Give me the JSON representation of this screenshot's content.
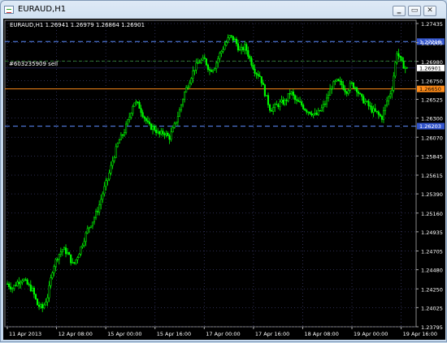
{
  "window": {
    "title": "EURAUD,H1",
    "minimize_glyph": "‗",
    "restore_glyph": "▭",
    "close_glyph": "✕"
  },
  "chart": {
    "header": "EURAUD,H1  1.26941 1.26979 1.26864 1.26901",
    "order_label": "#603235909 sell",
    "colors": {
      "background": "#000000",
      "candles": "#00ff00",
      "grid": "#3a3a6a",
      "axis_text": "#ffffff",
      "order_line": "#ff8c1a",
      "tp_sl_line": "#5b8cff",
      "bid_line": "#ffffff"
    }
  },
  "chart_data": {
    "type": "candlestick",
    "symbol": "EURAUD",
    "timeframe": "H1",
    "ohlc_last": {
      "open": 1.26941,
      "high": 1.26979,
      "low": 1.26864,
      "close": 1.26901
    },
    "y_ticks": [
      1.27435,
      1.27205,
      1.2698,
      1.2675,
      1.26525,
      1.263,
      1.2607,
      1.25845,
      1.25615,
      1.2539,
      1.2516,
      1.24935,
      1.24705,
      1.2448,
      1.2425,
      1.24025,
      1.23795
    ],
    "x_ticks": [
      "11 Apr 2013",
      "12 Apr 08:00",
      "15 Apr 00:00",
      "15 Apr 16:00",
      "17 Apr 00:00",
      "17 Apr 16:00",
      "18 Apr 08:00",
      "19 Apr 00:00",
      "19 Apr 16:00"
    ],
    "ylim": [
      1.23795,
      1.27435
    ],
    "levels": [
      {
        "name": "tp_sl_upper",
        "price": 1.27218,
        "label": "1.27218",
        "style": "blue-dash"
      },
      {
        "name": "order",
        "price": 1.2665,
        "label": "1.26650",
        "style": "orange"
      },
      {
        "name": "tp_sl_lower",
        "price": 1.26203,
        "label": "1.26203",
        "style": "blue-dash"
      },
      {
        "name": "bid",
        "price": 1.26901,
        "label": "1.26901",
        "style": "white"
      }
    ],
    "close_path": [
      [
        0.0,
        1.2431
      ],
      [
        0.01,
        1.2426
      ],
      [
        0.02,
        1.2433
      ],
      [
        0.03,
        1.2437
      ],
      [
        0.04,
        1.243
      ],
      [
        0.05,
        1.2423
      ],
      [
        0.06,
        1.2405
      ],
      [
        0.07,
        1.2402
      ],
      [
        0.08,
        1.2417
      ],
      [
        0.09,
        1.245
      ],
      [
        0.1,
        1.2465
      ],
      [
        0.11,
        1.2473
      ],
      [
        0.12,
        1.2467
      ],
      [
        0.13,
        1.2453
      ],
      [
        0.14,
        1.2466
      ],
      [
        0.15,
        1.2482
      ],
      [
        0.16,
        1.2498
      ],
      [
        0.17,
        1.2508
      ],
      [
        0.18,
        1.2522
      ],
      [
        0.19,
        1.2543
      ],
      [
        0.2,
        1.256
      ],
      [
        0.21,
        1.2583
      ],
      [
        0.22,
        1.2602
      ],
      [
        0.23,
        1.2612
      ],
      [
        0.24,
        1.2629
      ],
      [
        0.25,
        1.265
      ],
      [
        0.26,
        1.2645
      ],
      [
        0.27,
        1.2632
      ],
      [
        0.28,
        1.262
      ],
      [
        0.29,
        1.2618
      ],
      [
        0.3,
        1.261
      ],
      [
        0.31,
        1.2613
      ],
      [
        0.32,
        1.2606
      ],
      [
        0.33,
        1.262
      ],
      [
        0.34,
        1.2638
      ],
      [
        0.35,
        1.266
      ],
      [
        0.36,
        1.2675
      ],
      [
        0.37,
        1.269
      ],
      [
        0.38,
        1.2698
      ],
      [
        0.39,
        1.27
      ],
      [
        0.4,
        1.2687
      ],
      [
        0.41,
        1.2692
      ],
      [
        0.42,
        1.2707
      ],
      [
        0.43,
        1.2718
      ],
      [
        0.44,
        1.2728
      ],
      [
        0.45,
        1.2723
      ],
      [
        0.46,
        1.271
      ],
      [
        0.47,
        1.2716
      ],
      [
        0.48,
        1.27
      ],
      [
        0.49,
        1.2686
      ],
      [
        0.5,
        1.268
      ],
      [
        0.51,
        1.2658
      ],
      [
        0.52,
        1.264
      ],
      [
        0.53,
        1.2644
      ],
      [
        0.54,
        1.2648
      ],
      [
        0.55,
        1.265
      ],
      [
        0.56,
        1.2662
      ],
      [
        0.57,
        1.265
      ],
      [
        0.58,
        1.2647
      ],
      [
        0.59,
        1.264
      ],
      [
        0.6,
        1.2637
      ],
      [
        0.61,
        1.2633
      ],
      [
        0.62,
        1.264
      ],
      [
        0.63,
        1.265
      ],
      [
        0.64,
        1.2667
      ],
      [
        0.65,
        1.2674
      ],
      [
        0.66,
        1.2671
      ],
      [
        0.67,
        1.2662
      ],
      [
        0.68,
        1.2671
      ],
      [
        0.69,
        1.2666
      ],
      [
        0.7,
        1.2653
      ],
      [
        0.71,
        1.2648
      ],
      [
        0.72,
        1.264
      ],
      [
        0.73,
        1.2636
      ],
      [
        0.74,
        1.263
      ],
      [
        0.75,
        1.265
      ],
      [
        0.76,
        1.2665
      ],
      [
        0.77,
        1.271
      ],
      [
        0.78,
        1.2695
      ],
      [
        0.79,
        1.2689
      ]
    ]
  }
}
